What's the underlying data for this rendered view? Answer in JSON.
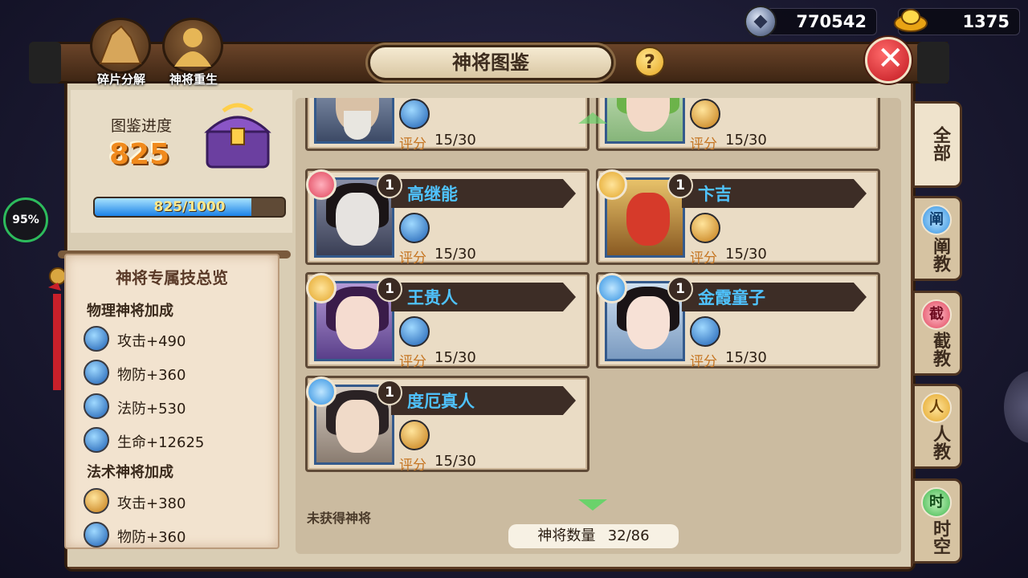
{
  "currency": {
    "silver": {
      "icon": "silver-coin-icon",
      "value": "770542"
    },
    "gold": {
      "icon": "gold-ingot-icon",
      "value": "1375"
    }
  },
  "top_actions": [
    {
      "label": "碎片分解",
      "icon": "fragment-pile-icon"
    },
    {
      "label": "神将重生",
      "icon": "rebirth-figure-icon"
    }
  ],
  "title": "神将图鉴",
  "help_label": "?",
  "close_icon": "close-x-icon",
  "progress": {
    "label": "图鉴进度",
    "value_text": "825",
    "bar_text": "825/1000",
    "fraction": 0.825,
    "chest_icon": "purple-treasure-chest-icon"
  },
  "percent_badge": "95%",
  "skills_overview": {
    "title": "神将专属技总览",
    "sections": [
      {
        "heading": "物理神将加成",
        "items": [
          {
            "text": "攻击+490",
            "icon": "blue-skill-icon"
          },
          {
            "text": "物防+360",
            "icon": "blue-skill-icon"
          },
          {
            "text": "法防+530",
            "icon": "blue-skill-icon"
          },
          {
            "text": "生命+12625",
            "icon": "blue-skill-icon"
          }
        ]
      },
      {
        "heading": "法术神将加成",
        "items": [
          {
            "text": "攻击+380",
            "icon": "gold-skill-icon"
          },
          {
            "text": "物防+360",
            "icon": "blue-skill-icon"
          }
        ]
      }
    ]
  },
  "cards": [
    {
      "name": "",
      "level": "",
      "faction": "",
      "skill": "blue",
      "rating_label": "评分",
      "rating": "15/30",
      "partial": true
    },
    {
      "name": "",
      "level": "",
      "faction": "",
      "skill": "gold",
      "rating_label": "评分",
      "rating": "15/30",
      "partial": true
    },
    {
      "name": "高继能",
      "level": "1",
      "faction": "red",
      "skill": "blue",
      "rating_label": "评分",
      "rating": "15/30"
    },
    {
      "name": "卞吉",
      "level": "1",
      "faction": "gold",
      "skill": "gold",
      "rating_label": "评分",
      "rating": "15/30"
    },
    {
      "name": "王贵人",
      "level": "1",
      "faction": "gold",
      "skill": "blue",
      "rating_label": "评分",
      "rating": "15/30"
    },
    {
      "name": "金霞童子",
      "level": "1",
      "faction": "blue",
      "skill": "blue",
      "rating_label": "评分",
      "rating": "15/30"
    },
    {
      "name": "度厄真人",
      "level": "1",
      "faction": "blue",
      "skill": "gold",
      "rating_label": "评分",
      "rating": "15/30"
    }
  ],
  "unobtained_label": "未获得神将",
  "count": {
    "label": "神将数量",
    "value": "32/86"
  },
  "tabs": [
    {
      "label": "全部",
      "icon": "",
      "active": true
    },
    {
      "label": "阐教",
      "icon_text": "阐",
      "icon": "chan-faction-icon"
    },
    {
      "label": "截教",
      "icon_text": "截",
      "icon": "jie-faction-icon"
    },
    {
      "label": "人教",
      "icon_text": "人",
      "icon": "ren-faction-icon"
    },
    {
      "label": "时空",
      "icon_text": "时",
      "icon": "shikong-faction-icon"
    }
  ],
  "colors": {
    "name_blue": "#4fc3ff",
    "progress_orange": "#f08a1d",
    "faction_red": "#e0445a",
    "faction_gold": "#e3a62a",
    "faction_blue": "#2f8fe0"
  }
}
